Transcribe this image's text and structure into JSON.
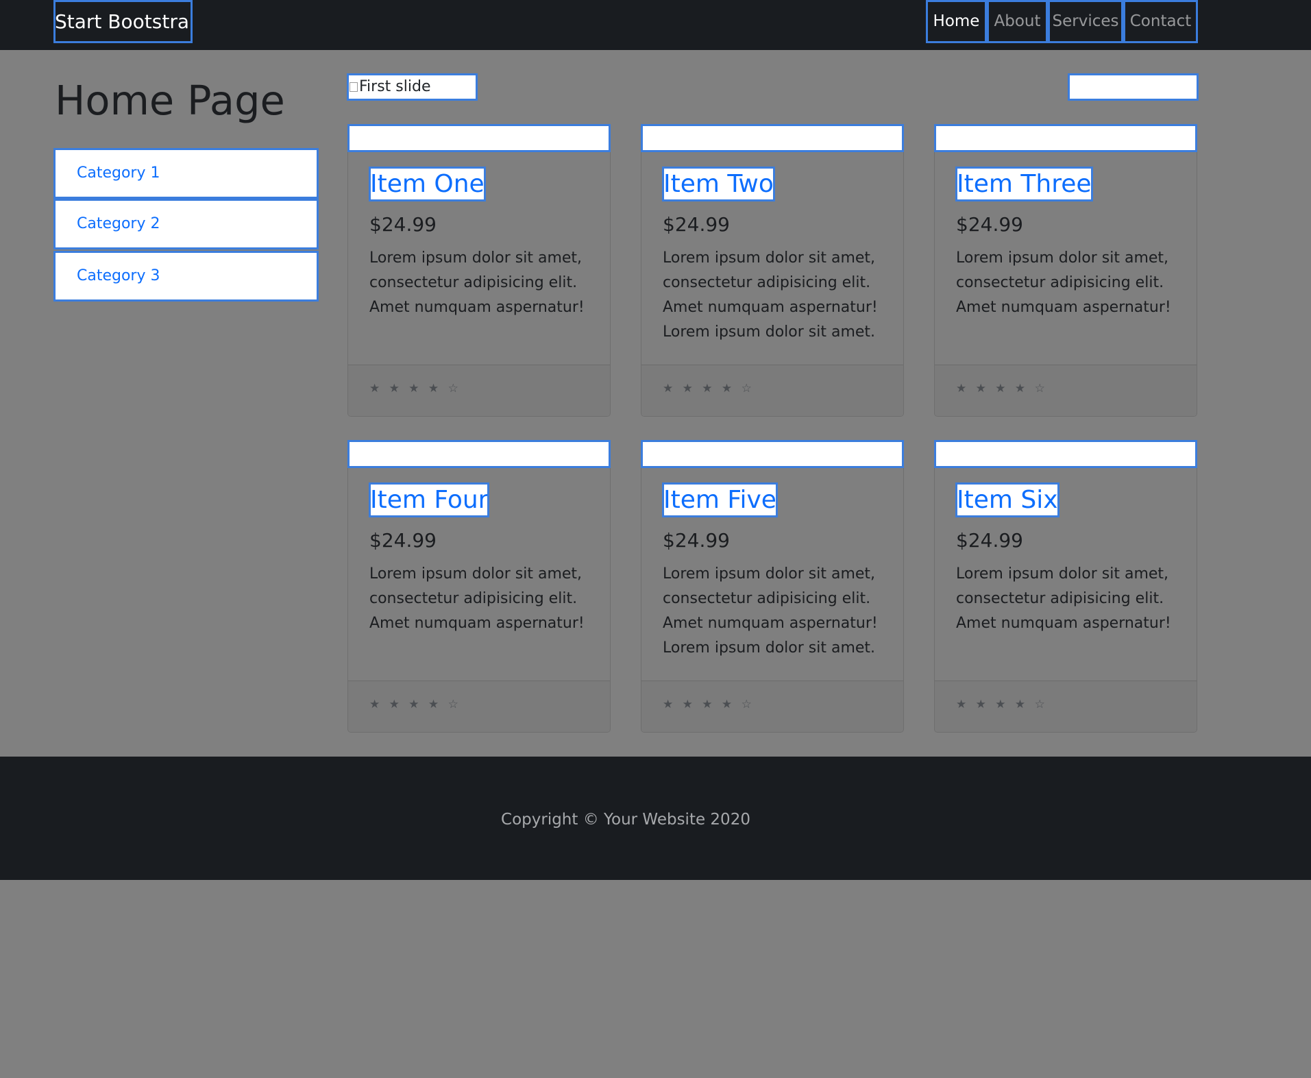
{
  "navbar": {
    "brand": "Start Bootstrap",
    "links": [
      {
        "label": "Home",
        "active": true
      },
      {
        "label": "About",
        "active": false
      },
      {
        "label": "Services",
        "active": false
      },
      {
        "label": "Contact",
        "active": false
      }
    ]
  },
  "sidebar": {
    "title": "Home Page",
    "categories": [
      "Category 1",
      "Category 2",
      "Category 3"
    ]
  },
  "carousel": {
    "slide_alt": "First slide"
  },
  "products": [
    {
      "title": "Item One",
      "price": "$24.99",
      "text": "Lorem ipsum dolor sit amet, consectetur adipisicing elit. Amet numquam aspernatur!",
      "rating": "★ ★ ★ ★ ☆"
    },
    {
      "title": "Item Two",
      "price": "$24.99",
      "text": "Lorem ipsum dolor sit amet, consectetur adipisicing elit. Amet numquam aspernatur! Lorem ipsum dolor sit amet.",
      "rating": "★ ★ ★ ★ ☆"
    },
    {
      "title": "Item Three",
      "price": "$24.99",
      "text": "Lorem ipsum dolor sit amet, consectetur adipisicing elit. Amet numquam aspernatur!",
      "rating": "★ ★ ★ ★ ☆"
    },
    {
      "title": "Item Four",
      "price": "$24.99",
      "text": "Lorem ipsum dolor sit amet, consectetur adipisicing elit. Amet numquam aspernatur!",
      "rating": "★ ★ ★ ★ ☆"
    },
    {
      "title": "Item Five",
      "price": "$24.99",
      "text": "Lorem ipsum dolor sit amet, consectetur adipisicing elit. Amet numquam aspernatur! Lorem ipsum dolor sit amet.",
      "rating": "★ ★ ★ ★ ☆"
    },
    {
      "title": "Item Six",
      "price": "$24.99",
      "text": "Lorem ipsum dolor sit amet, consectetur adipisicing elit. Amet numquam aspernatur!",
      "rating": "★ ★ ★ ★ ☆"
    }
  ],
  "footer": {
    "copyright": "Copyright © Your Website 2020"
  },
  "colors": {
    "navbar_bg": "#191c20",
    "page_bg": "#808080",
    "link": "#0d6efd",
    "highlight": "#3b7ddd"
  }
}
